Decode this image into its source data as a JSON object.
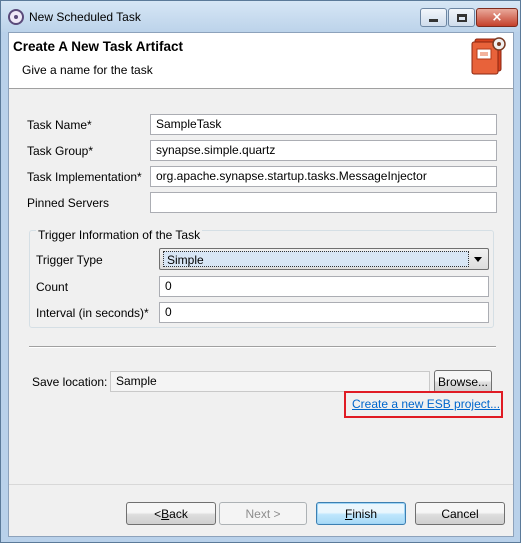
{
  "window": {
    "title": "New Scheduled Task",
    "controls": {
      "minimize": "minimize",
      "maximize": "maximize",
      "close": "×"
    }
  },
  "header": {
    "title": "Create A New Task Artifact",
    "description": "Give a name for the task",
    "icon": "task-artifact-icon"
  },
  "form": {
    "task_name": {
      "label": "Task Name*",
      "value": "SampleTask"
    },
    "task_group": {
      "label": "Task Group*",
      "value": "synapse.simple.quartz"
    },
    "task_impl": {
      "label": "Task Implementation*",
      "value": "org.apache.synapse.startup.tasks.MessageInjector"
    },
    "pinned_servers": {
      "label": "Pinned Servers",
      "value": ""
    }
  },
  "trigger": {
    "group_title": "Trigger Information of the Task",
    "type": {
      "label": "Trigger Type",
      "value": "Simple"
    },
    "count": {
      "label": "Count",
      "value": "0"
    },
    "interval": {
      "label": "Interval (in seconds)*",
      "value": "0"
    }
  },
  "save": {
    "label": "Save location:",
    "value": "Sample",
    "browse": "Browse...",
    "new_project_link": "Create a new ESB project..."
  },
  "buttons": {
    "back": {
      "pre": "< ",
      "u": "B",
      "post": "ack"
    },
    "next": "Next >",
    "finish": {
      "pre": "",
      "u": "F",
      "post": "inish"
    },
    "cancel": "Cancel"
  },
  "colors": {
    "highlight": "#e01b24",
    "link": "#0066cc"
  }
}
